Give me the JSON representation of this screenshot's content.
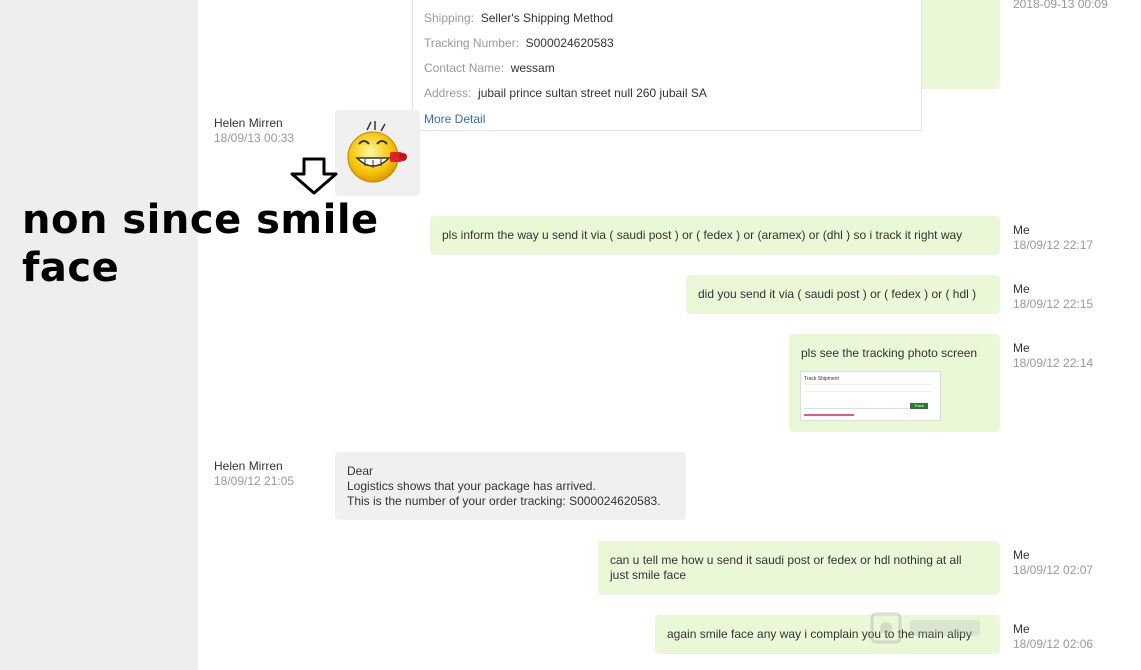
{
  "order": {
    "shipping_label": "Shipping",
    "shipping_value": "Seller's Shipping Method",
    "tracking_label": "Tracking Number",
    "tracking_value": "S000024620583",
    "contact_label": "Contact Name",
    "contact_value": "wessam",
    "address_label": "Address",
    "address_value": "jubail prince sultan street null 260 jubail SA",
    "more_detail": "More Detail"
  },
  "top_timestamp": "2018-09-13 00:09",
  "annotation": {
    "line1": "non since smile",
    "line2": "face"
  },
  "messages": [
    {
      "sender": "Helen Mirren",
      "time": "18/09/13 00:33",
      "type": "sticker",
      "sticker_icon": "grinning-emoji-sticker-icon"
    },
    {
      "sender": "Me",
      "time": "18/09/12 22:17",
      "lines": [
        "pls inform the way u send it via ( saudi post ) or ( fedex ) or (aramex) or (dhl ) so i track it right way"
      ]
    },
    {
      "sender": "Me",
      "time": "18/09/12 22:15",
      "lines": [
        "did you send it via ( saudi post ) or ( fedex ) or ( hdl )"
      ]
    },
    {
      "sender": "Me",
      "time": "18/09/12 22:14",
      "lines": [
        "pls see the tracking photo screen"
      ],
      "attachment": {
        "title": "Track Shipment",
        "button": "Track"
      }
    },
    {
      "sender": "Helen Mirren",
      "time": "18/09/12 21:05",
      "lines": [
        "Dear",
        "Logistics shows that your package has arrived.",
        "This is the number of your order tracking: S000024620583."
      ]
    },
    {
      "sender": "Me",
      "time": "18/09/12 02:07",
      "lines": [
        "can u tell me how u send it  saudi post or fedex or hdl nothing at all",
        "just smile face"
      ]
    },
    {
      "sender": "Me",
      "time": "18/09/12 02:06",
      "lines": [
        "again smile face any way i complain you to the main alipy"
      ]
    }
  ],
  "colors": {
    "me_bubble": "#eaf8d8",
    "them_bubble": "#f0f0f0",
    "link": "#2f6fb3",
    "gutter": "#eeeeee"
  }
}
